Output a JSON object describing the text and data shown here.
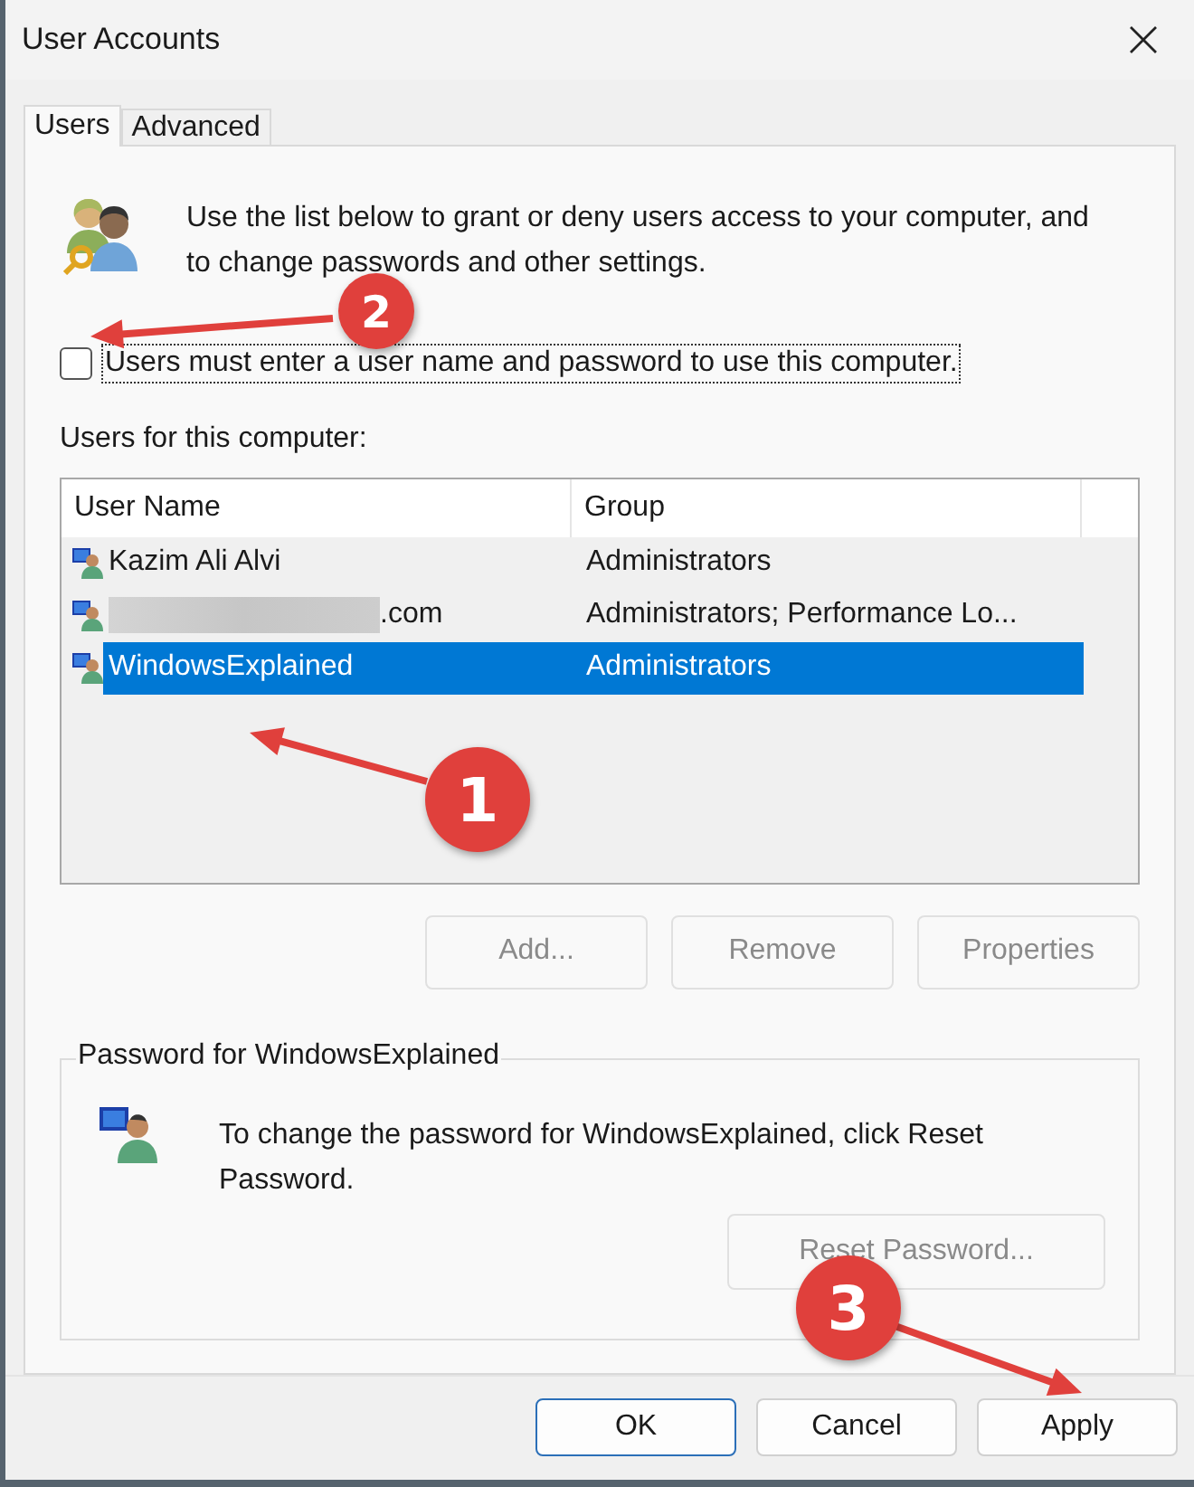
{
  "window": {
    "title": "User Accounts"
  },
  "tabs": [
    {
      "label": "Users",
      "selected": true
    },
    {
      "label": "Advanced",
      "selected": false
    }
  ],
  "intro": "Use the list below to grant or deny users access to your computer, and to change passwords and other settings.",
  "require_login": {
    "label": "Users must enter a user name and password to use this computer.",
    "checked": false
  },
  "users_label": "Users for this computer:",
  "table": {
    "columns": [
      "User Name",
      "Group"
    ],
    "rows": [
      {
        "name": "Kazim Ali Alvi",
        "group": "Administrators",
        "selected": false,
        "redacted": false
      },
      {
        "name": ".com",
        "group": "Administrators; Performance Lo...",
        "selected": false,
        "redacted": true
      },
      {
        "name": "WindowsExplained",
        "group": "Administrators",
        "selected": true,
        "redacted": false
      }
    ]
  },
  "list_buttons": [
    {
      "label": "Add...",
      "disabled": true
    },
    {
      "label": "Remove",
      "disabled": true
    },
    {
      "label": "Properties",
      "disabled": true
    }
  ],
  "password_group": {
    "title": "Password for WindowsExplained",
    "text": "To change the password for WindowsExplained, click Reset Password.",
    "button": {
      "label": "Reset Password...",
      "disabled": true
    }
  },
  "dialog_buttons": [
    {
      "label": "OK",
      "default": true
    },
    {
      "label": "Cancel",
      "default": false
    },
    {
      "label": "Apply",
      "default": false
    }
  ],
  "annotations": [
    {
      "number": "2"
    },
    {
      "number": "1"
    },
    {
      "number": "3"
    }
  ]
}
